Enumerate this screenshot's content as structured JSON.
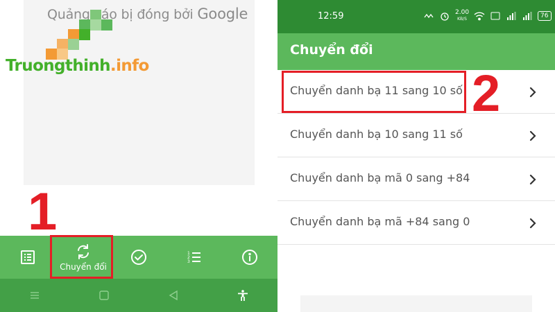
{
  "left_screen": {
    "ad_banner": {
      "text_prefix": "Quảng cáo bị đóng bởi",
      "text_brand": "Google"
    },
    "watermark": {
      "name": "Truongthinh",
      "dot": ".",
      "tld": "info"
    },
    "step_label": "1",
    "bottom_nav": {
      "items": [
        {
          "icon": "list-icon",
          "label": ""
        },
        {
          "icon": "sync-icon",
          "label": "Chuyển đổi"
        },
        {
          "icon": "check-circle-icon",
          "label": ""
        },
        {
          "icon": "numbered-list-icon",
          "label": ""
        },
        {
          "icon": "info-icon",
          "label": ""
        }
      ]
    },
    "system_nav": [
      "menu-icon",
      "home-icon",
      "back-icon",
      "accessibility-icon"
    ]
  },
  "right_screen": {
    "status_bar": {
      "time": "12:59",
      "speed": "2.00",
      "speed_unit": "KB/S",
      "battery": "76"
    },
    "app_bar": {
      "title": "Chuyển đổi"
    },
    "step_label": "2",
    "options": [
      {
        "label": "Chuyển danh bạ 11 sang 10 số"
      },
      {
        "label": "Chuyển danh bạ 10 sang 11 số"
      },
      {
        "label": "Chuyển danh bạ mã 0 sang +84"
      },
      {
        "label": "Chuyển danh bạ mã +84 sang 0"
      }
    ]
  },
  "colors": {
    "green": "#5cb85c",
    "dark_green": "#2e8b33",
    "highlight_red": "#e41e26",
    "logo_orange": "#f39a35"
  }
}
